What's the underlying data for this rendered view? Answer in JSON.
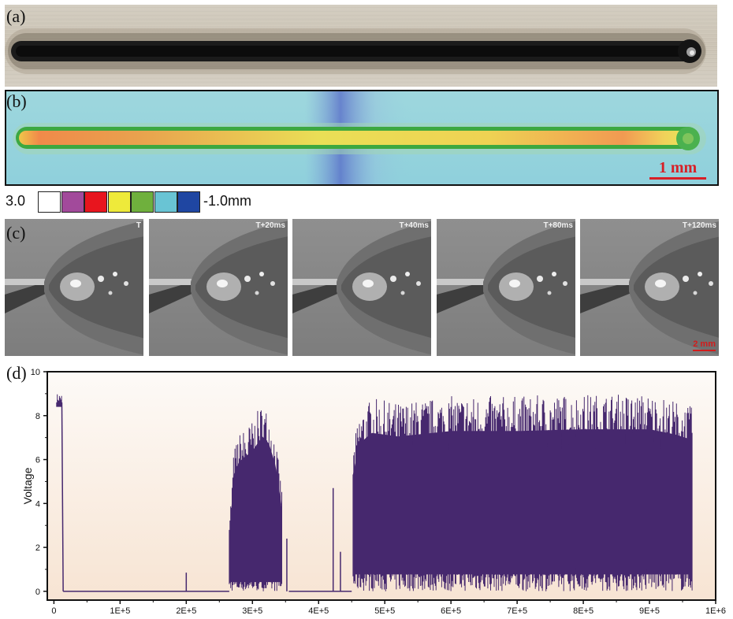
{
  "panels": {
    "a": {
      "letter": "(a)"
    },
    "b": {
      "letter": "(b)",
      "scale_bar": "1 mm"
    },
    "colorbar": {
      "max_label": "3.0",
      "min_label": "-1.0mm",
      "colors": [
        "#ffffff",
        "#a24a9b",
        "#e8151e",
        "#eeea3a",
        "#6fb03d",
        "#69c4d4",
        "#1f46a2"
      ]
    },
    "c": {
      "letter": "(c)",
      "frames": [
        {
          "label": "T"
        },
        {
          "label": "T+20ms"
        },
        {
          "label": "T+40ms"
        },
        {
          "label": "T+80ms"
        },
        {
          "label": "T+120ms"
        }
      ],
      "scale_bar": "2 mm"
    },
    "d": {
      "letter": "(d)"
    }
  },
  "chart_data": {
    "type": "line",
    "title": "",
    "xlabel": "",
    "ylabel": "Voltage",
    "xlim": [
      -10000,
      1000000
    ],
    "ylim": [
      -0.4,
      10
    ],
    "x_ticks": [
      0,
      100000,
      200000,
      300000,
      400000,
      500000,
      600000,
      700000,
      800000,
      900000,
      1000000
    ],
    "x_tick_labels": [
      "0",
      "1E+5",
      "2E+5",
      "3E+5",
      "4E+5",
      "5E+5",
      "6E+5",
      "7E+5",
      "8E+5",
      "9E+5",
      "1E+6"
    ],
    "y_ticks": [
      0,
      2,
      4,
      6,
      8,
      10
    ],
    "y_tick_labels": [
      "0",
      "2",
      "4",
      "6",
      "8",
      "10"
    ],
    "series_color": "#46286e",
    "background_gradient": [
      "#fdfaf7",
      "#f7e4d3"
    ],
    "segments": [
      {
        "type": "burst",
        "x_start": 4000,
        "x_end": 12000,
        "low": 8.6,
        "high": 9.0
      },
      {
        "type": "decay",
        "x_start": 12000,
        "x_end": 14000,
        "from": 8.6,
        "to": 0
      },
      {
        "type": "baseline",
        "x_start": 14000,
        "x_end": 265000,
        "value": 0
      },
      {
        "type": "spike",
        "x": 200000,
        "value": 0.85
      },
      {
        "type": "burst",
        "x_start": 265000,
        "x_end": 345000,
        "envelope": [
          [
            265000,
            3.0
          ],
          [
            272000,
            6.5
          ],
          [
            280000,
            7.2
          ],
          [
            300000,
            7.8
          ],
          [
            315000,
            8.6
          ],
          [
            325000,
            8.2
          ],
          [
            335000,
            7.0
          ],
          [
            345000,
            4.5
          ]
        ],
        "low_max": 0.6
      },
      {
        "type": "spike",
        "x": 352000,
        "value": 2.4
      },
      {
        "type": "baseline",
        "x_start": 355000,
        "x_end": 450000,
        "value": 0
      },
      {
        "type": "spike",
        "x": 422000,
        "value": 4.7
      },
      {
        "type": "spike",
        "x": 433000,
        "value": 1.8
      },
      {
        "type": "burst",
        "x_start": 452000,
        "x_end": 965000,
        "envelope": [
          [
            452000,
            6.5
          ],
          [
            462000,
            8.2
          ],
          [
            480000,
            8.8
          ],
          [
            520000,
            8.6
          ],
          [
            600000,
            8.9
          ],
          [
            700000,
            8.9
          ],
          [
            800000,
            9.0
          ],
          [
            900000,
            9.0
          ],
          [
            940000,
            8.7
          ],
          [
            965000,
            8.4
          ]
        ],
        "low_max": 1.1
      }
    ]
  }
}
